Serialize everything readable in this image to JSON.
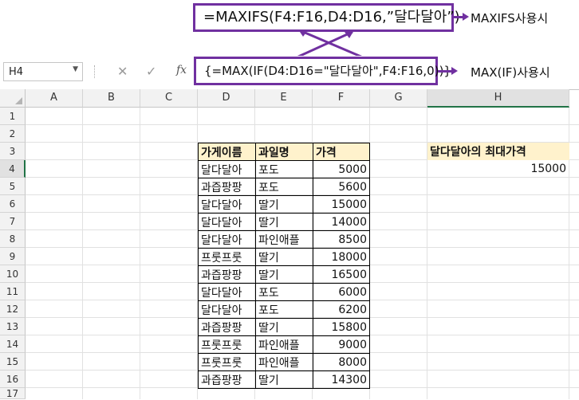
{
  "callouts": {
    "maxifs_formula": "=MAXIFS(F4:F16,D4:D16,”달다달아”)",
    "maxifs_note": "MAXIFS사용시",
    "maxif_formula": "{=MAX(IF(D4:D16=\"달다달아\",F4:F16,0))}",
    "maxif_note": "MAX(IF)사용시"
  },
  "formula_bar": {
    "name_box": "H4",
    "cancel_icon": "✕",
    "enter_icon": "✓",
    "fx_label": "fx"
  },
  "columns": [
    "A",
    "B",
    "C",
    "D",
    "E",
    "F",
    "G",
    "H"
  ],
  "rows": [
    "1",
    "2",
    "3",
    "4",
    "5",
    "6",
    "7",
    "8",
    "9",
    "10",
    "11",
    "12",
    "13",
    "14",
    "15",
    "16",
    "17"
  ],
  "table": {
    "headers": [
      "가게이름",
      "과일명",
      "가격"
    ],
    "rows": [
      [
        "달다달아",
        "포도",
        "5000"
      ],
      [
        "과즙팡팡",
        "포도",
        "5600"
      ],
      [
        "달다달아",
        "딸기",
        "15000"
      ],
      [
        "달다달아",
        "딸기",
        "14000"
      ],
      [
        "달다달아",
        "파인애플",
        "8500"
      ],
      [
        "프룻프룻",
        "딸기",
        "18000"
      ],
      [
        "과즙팡팡",
        "딸기",
        "16500"
      ],
      [
        "달다달아",
        "포도",
        "6000"
      ],
      [
        "달다달아",
        "포도",
        "6200"
      ],
      [
        "과즙팡팡",
        "딸기",
        "15800"
      ],
      [
        "프룻프룻",
        "파인애플",
        "9000"
      ],
      [
        "프룻프룻",
        "파인애플",
        "8000"
      ],
      [
        "과즙팡팡",
        "딸기",
        "14300"
      ]
    ]
  },
  "result": {
    "label": "달다달아의 최대가격",
    "value": "15000"
  },
  "colors": {
    "accent": "#7030a0",
    "header_fill": "#fff2cc"
  }
}
